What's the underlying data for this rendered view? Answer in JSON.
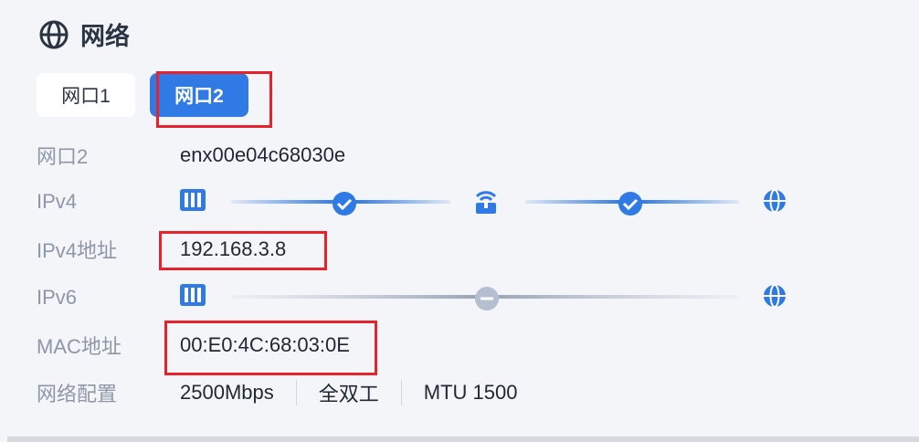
{
  "section": {
    "title": "网络",
    "icon": "globe-icon"
  },
  "tabs": [
    {
      "label": "网口1",
      "active": false
    },
    {
      "label": "网口2",
      "active": true
    }
  ],
  "fields": {
    "port": {
      "label": "网口2",
      "value": "enx00e04c68030e"
    },
    "ipv4": {
      "label": "IPv4",
      "status": "connected"
    },
    "ipv4_addr": {
      "label": "IPv4地址",
      "value": "192.168.3.8"
    },
    "ipv6": {
      "label": "IPv6",
      "status": "disconnected"
    },
    "mac": {
      "label": "MAC地址",
      "value": "00:E0:4C:68:03:0E"
    },
    "config": {
      "label": "网络配置",
      "speed": "2500Mbps",
      "duplex": "全双工",
      "mtu": "MTU 1500"
    }
  },
  "colors": {
    "accent": "#2f7ae5",
    "inactive_line": "#b4bfcf",
    "highlight": "#e8222a"
  }
}
